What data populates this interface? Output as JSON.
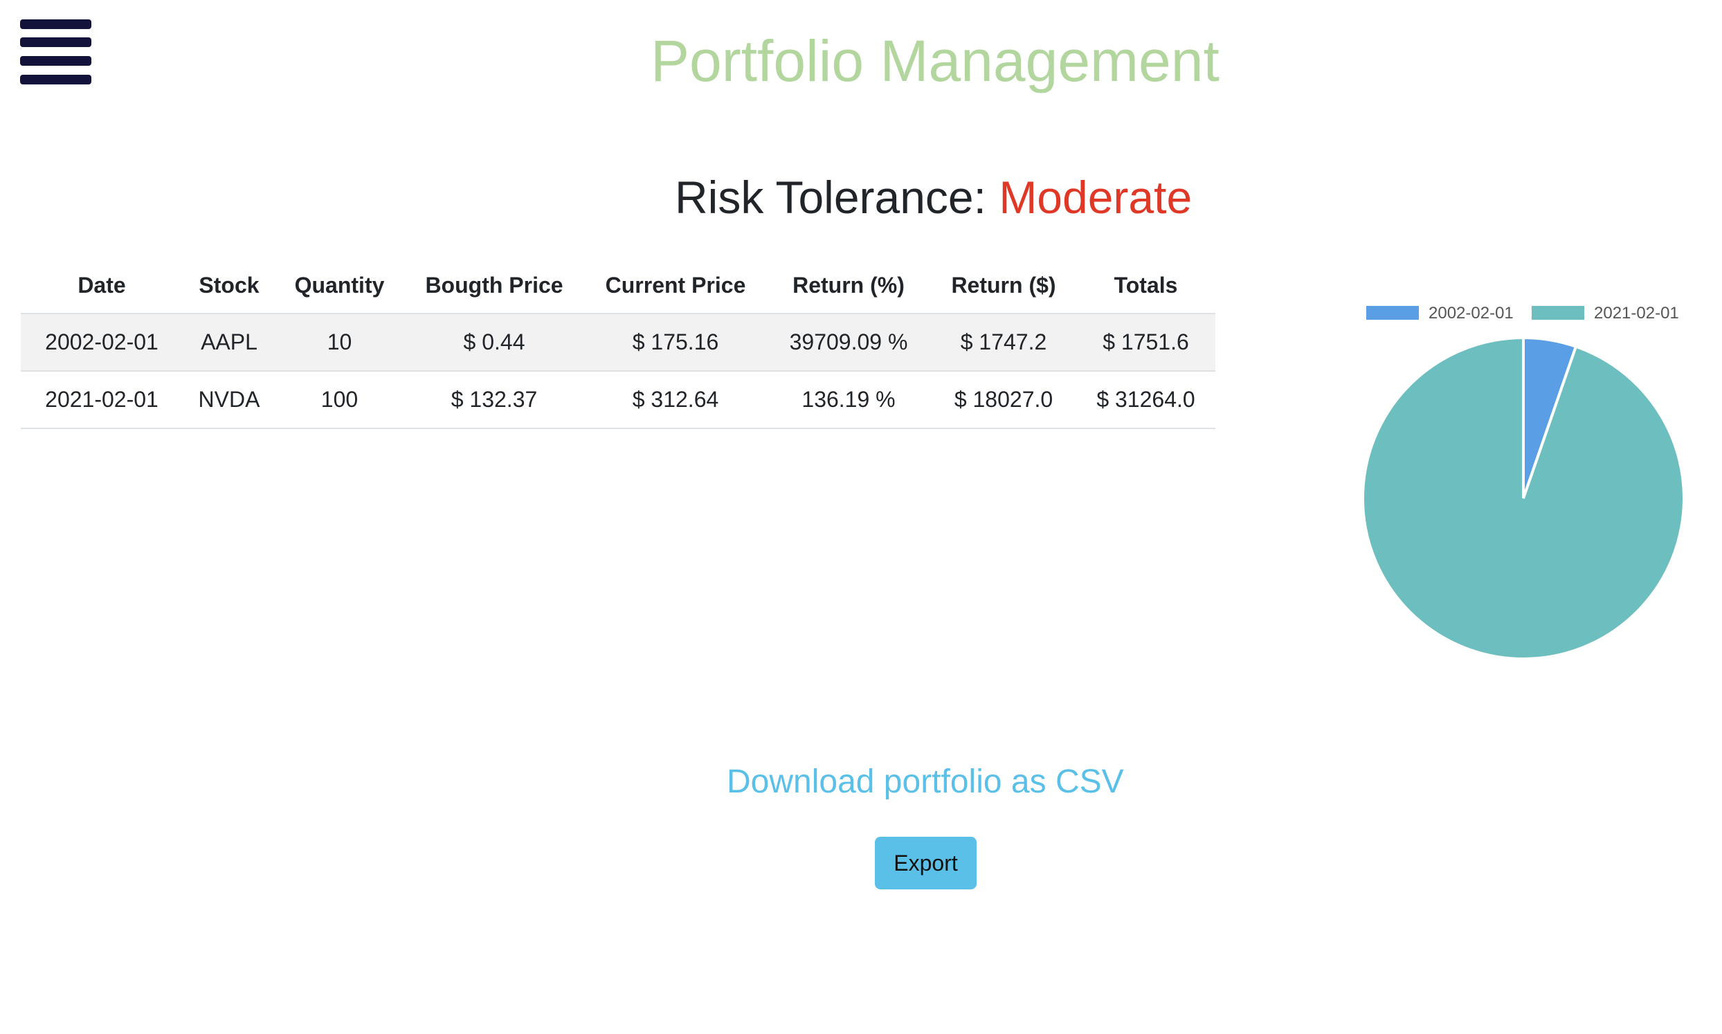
{
  "header": {
    "menu_icon": "hamburger-menu-icon",
    "title": "Portfolio Management",
    "title_color": "#b2d69e",
    "menu_color": "#13123a"
  },
  "risk": {
    "label": "Risk Tolerance:",
    "value": "Moderate",
    "value_color": "#e03827"
  },
  "table": {
    "headers": [
      "Date",
      "Stock",
      "Quantity",
      "Bougth Price",
      "Current Price",
      "Return (%)",
      "Return ($)",
      "Totals"
    ],
    "rows": [
      [
        "2002-02-01",
        "AAPL",
        "10",
        "$ 0.44",
        "$ 175.16",
        "39709.09 %",
        "$ 1747.2",
        "$ 1751.6"
      ],
      [
        "2021-02-01",
        "NVDA",
        "100",
        "$ 132.37",
        "$ 312.64",
        "136.19 %",
        "$ 18027.0",
        "$ 31264.0"
      ]
    ]
  },
  "chart_data": {
    "type": "pie",
    "categories": [
      "2002-02-01",
      "2021-02-01"
    ],
    "values": [
      1751.6,
      31264.0
    ],
    "colors": [
      "#5a9fe6",
      "#6cbfbe"
    ],
    "legend_position": "top"
  },
  "download": {
    "heading": "Download portfolio as CSV",
    "heading_color": "#5bc0e8",
    "button_label": "Export",
    "button_color": "#5bc0e8"
  }
}
